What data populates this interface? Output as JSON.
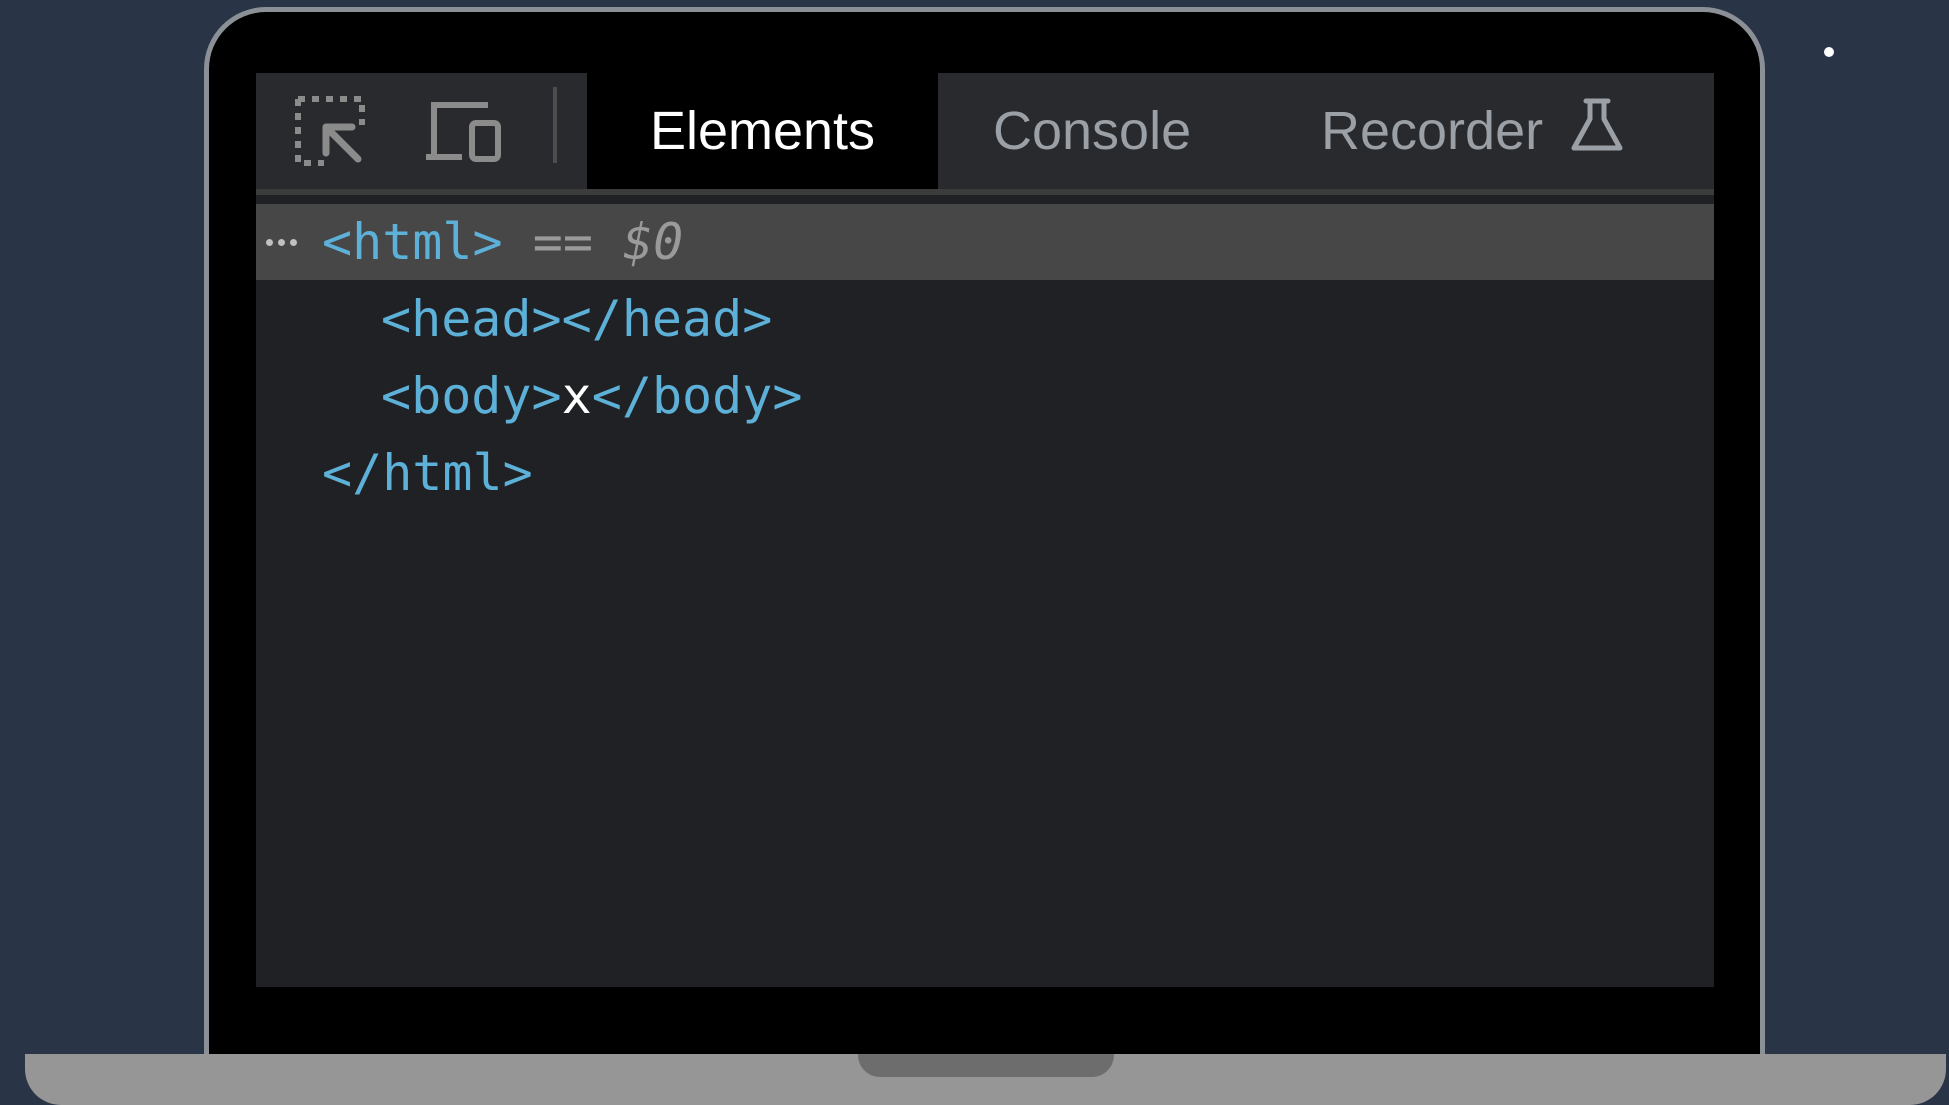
{
  "devtools": {
    "toolbar": {
      "icons": {
        "inspect": "inspect-element-icon",
        "device": "device-toolbar-icon",
        "flask": "flask-icon"
      },
      "tabs": [
        {
          "label": "Elements",
          "active": true
        },
        {
          "label": "Console",
          "active": false
        },
        {
          "label": "Recorder",
          "active": false
        }
      ]
    },
    "dom_tree": {
      "line1": {
        "tag": "<html>",
        "separator": " == ",
        "ref": "$0"
      },
      "line2": {
        "tag": "<head></head>"
      },
      "line3": {
        "open": "<body>",
        "text": "x",
        "close": "</body>"
      },
      "line4": {
        "tag": "</html>"
      }
    }
  },
  "colors": {
    "background": "#293447",
    "panel": "#202124",
    "toolbar": "#292a2d",
    "selected_row": "#474747",
    "tag": "#5db0d7",
    "muted": "#9a9a9a",
    "active_tab_text": "#ffffff",
    "inactive_tab_text": "#9aa0a6",
    "laptop_frame": "#8b8f96",
    "laptop_base": "#969696"
  }
}
